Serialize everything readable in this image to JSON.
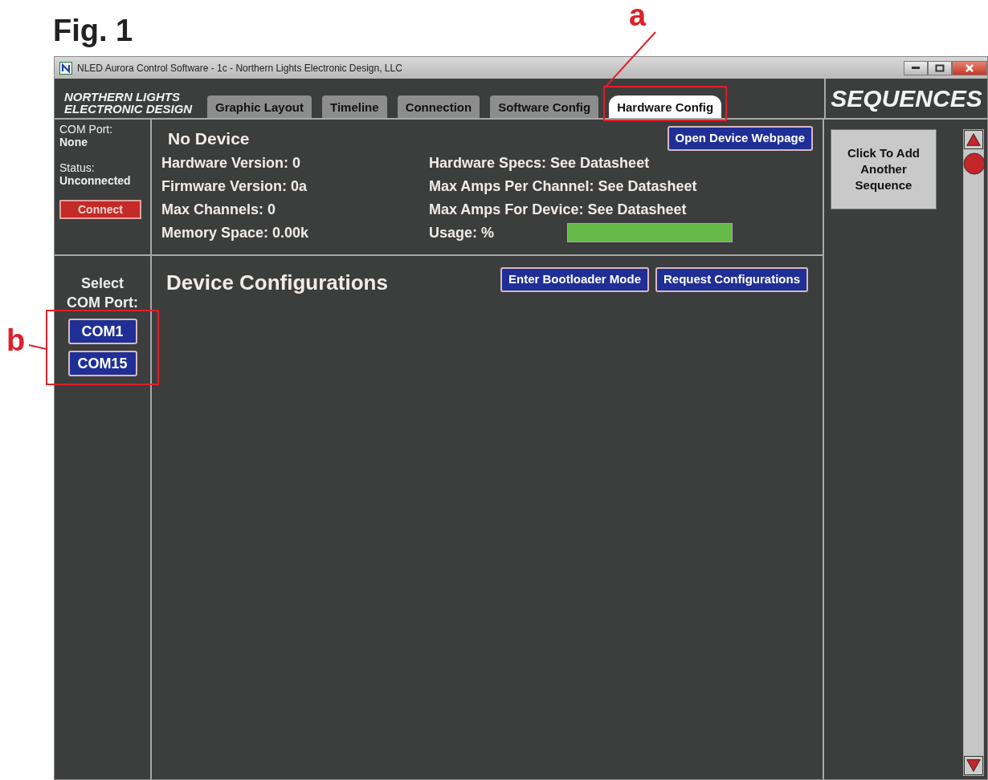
{
  "figure": {
    "label": "Fig. 1",
    "callouts": [
      {
        "label": "a"
      },
      {
        "label": "b"
      }
    ]
  },
  "window": {
    "title": "NLED Aurora Control Software - 1c - Northern Lights Electronic Design, LLC"
  },
  "logo": {
    "lines": [
      "NORTHERN LIGHTS",
      "ELECTRONIC DESIGN"
    ]
  },
  "tabs": [
    {
      "label": "Graphic Layout",
      "selected": false
    },
    {
      "label": "Timeline",
      "selected": false
    },
    {
      "label": "Connection",
      "selected": false
    },
    {
      "label": "Software Config",
      "selected": false
    },
    {
      "label": "Hardware Config",
      "selected": true
    }
  ],
  "sequences_header": "SEQUENCES",
  "connection_status": {
    "com_port_label": "COM Port:",
    "com_port": "None",
    "status_label": "Status:",
    "status": "Unconnected",
    "button": "Connect"
  },
  "device": {
    "name": "No Device",
    "button": "Open Device Webpage",
    "info_left": [
      "Hardware Version: 0",
      "Firmware Version: 0a",
      "Max Channels: 0",
      "Memory Space: 0.00k"
    ],
    "info_right": [
      "Hardware Specs: See Datasheet",
      "Max Amps Per Channel: See Datasheet",
      "Max Amps For Device: See Datasheet"
    ],
    "usage": {
      "label": "Usage:  %",
      "level": 1
    }
  },
  "configurations": {
    "title": "Device Configurations",
    "buttons": [
      "Enter Bootloader Mode",
      "Request Configurations"
    ]
  },
  "com_select": {
    "title_lines": [
      "Select",
      "COM Port:"
    ],
    "ports": [
      "COM1",
      "COM15"
    ]
  },
  "sequences": {
    "add_button": "Click To Add Another Sequence"
  }
}
